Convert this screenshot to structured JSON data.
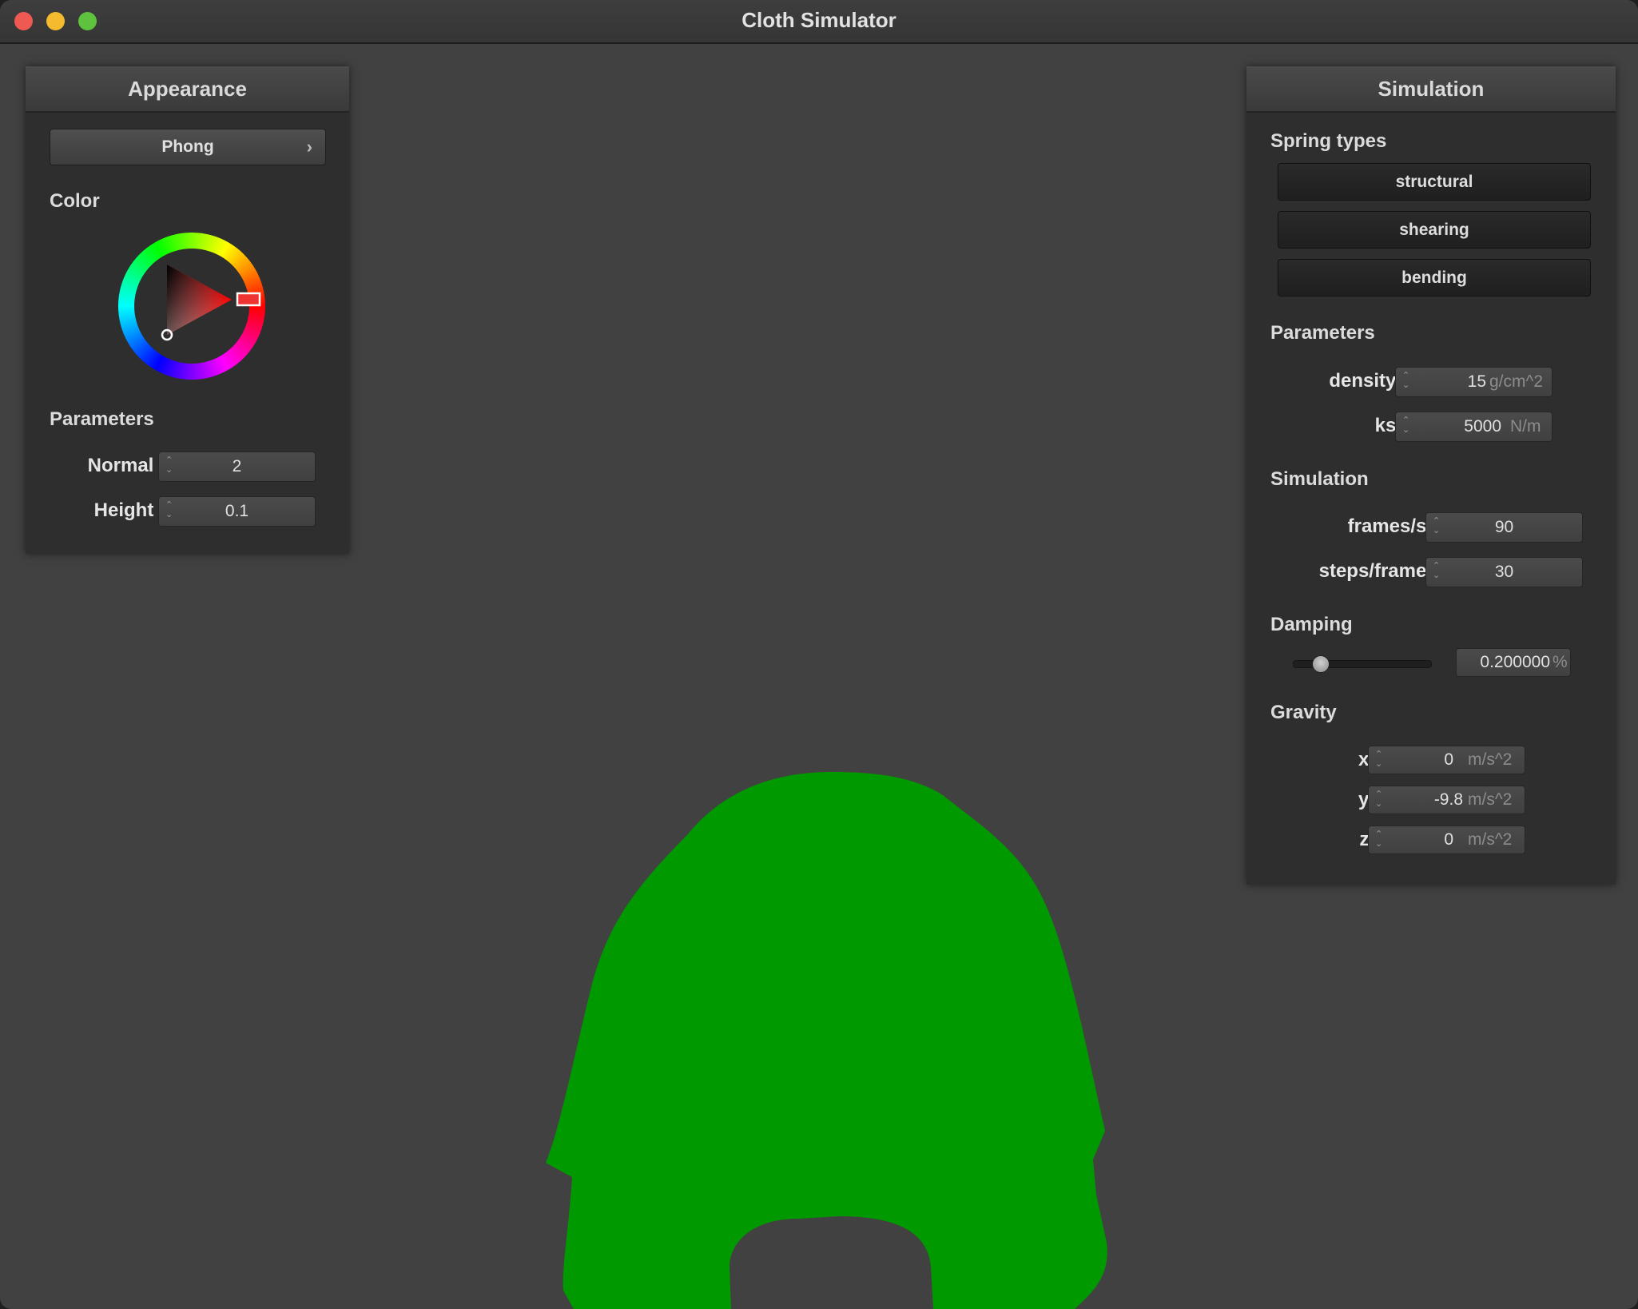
{
  "window": {
    "title": "Cloth Simulator"
  },
  "colors": {
    "cloth": "#009900",
    "viewport_bg": "#414141",
    "selected_color": "#ff0000"
  },
  "appearance": {
    "header": "Appearance",
    "shader_value": "Phong",
    "color_label": "Color",
    "parameters_label": "Parameters",
    "normal": {
      "label": "Normal :",
      "value": "2"
    },
    "height": {
      "label": "Height :",
      "value": "0.1"
    }
  },
  "simulation_panel": {
    "header": "Simulation",
    "spring_types_label": "Spring types",
    "spring_types": [
      "structural",
      "shearing",
      "bending"
    ],
    "parameters_label": "Parameters",
    "density": {
      "label": "density :",
      "value": "15",
      "unit": "g/cm^2"
    },
    "ks": {
      "label": "ks :",
      "value": "5000",
      "unit": "N/m"
    },
    "simulation_label": "Simulation",
    "fps": {
      "label": "frames/s :",
      "value": "90"
    },
    "steps": {
      "label": "steps/frame :",
      "value": "30"
    },
    "damping_label": "Damping",
    "damping": {
      "value": "0.200000",
      "unit": "%",
      "slider_fraction": 0.2
    },
    "gravity_label": "Gravity",
    "gravity": [
      {
        "label": "x :",
        "value": "0",
        "unit": "m/s^2"
      },
      {
        "label": "y :",
        "value": "-9.8",
        "unit": "m/s^2"
      },
      {
        "label": "z :",
        "value": "0",
        "unit": "m/s^2"
      }
    ]
  }
}
